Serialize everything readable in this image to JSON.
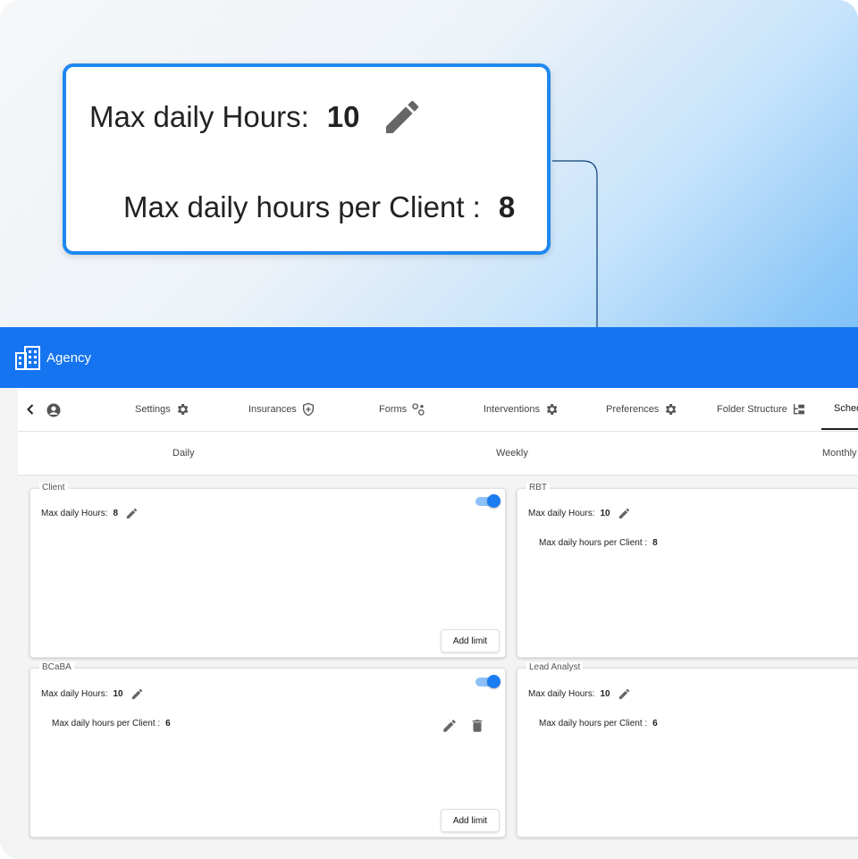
{
  "zoom": {
    "max_daily_label": "Max daily Hours:",
    "max_daily_value": "10",
    "per_client_label": "Max daily hours per Client :",
    "per_client_value": "8"
  },
  "appbar": {
    "title": "Agency",
    "logo_icon": "building-icon"
  },
  "tabs": [
    {
      "label": "Settings",
      "icon": "gear-icon"
    },
    {
      "label": "Insurances",
      "icon": "shield-plus-icon"
    },
    {
      "label": "Forms",
      "icon": "forms-icon"
    },
    {
      "label": "Interventions",
      "icon": "gear-icon"
    },
    {
      "label": "Preferences",
      "icon": "gear-icon"
    },
    {
      "label": "Folder Structure",
      "icon": "folder-tree-icon"
    },
    {
      "label": "Sched",
      "active": true
    }
  ],
  "subtabs": [
    "Daily",
    "Weekly",
    "Monthly"
  ],
  "cards": {
    "client": {
      "title": "Client",
      "max_daily_label": "Max daily Hours:",
      "max_daily_value": "8",
      "toggle_on": true,
      "add_limit": "Add limit"
    },
    "rbt": {
      "title": "RBT",
      "max_daily_label": "Max daily Hours:",
      "max_daily_value": "10",
      "per_client_label": "Max daily hours per Client :",
      "per_client_value": "8"
    },
    "bcaba": {
      "title": "BCaBA",
      "max_daily_label": "Max daily Hours:",
      "max_daily_value": "10",
      "per_client_label": "Max daily hours per Client :",
      "per_client_value": "6",
      "toggle_on": true,
      "add_limit": "Add limit"
    },
    "lead": {
      "title": "Lead Analyst",
      "max_daily_label": "Max daily Hours:",
      "max_daily_value": "10",
      "per_client_label": "Max daily hours per Client :",
      "per_client_value": "6"
    }
  },
  "colors": {
    "accent": "#1574f0",
    "highlight_border": "#1e88f0",
    "connector": "#0d3f7a"
  }
}
